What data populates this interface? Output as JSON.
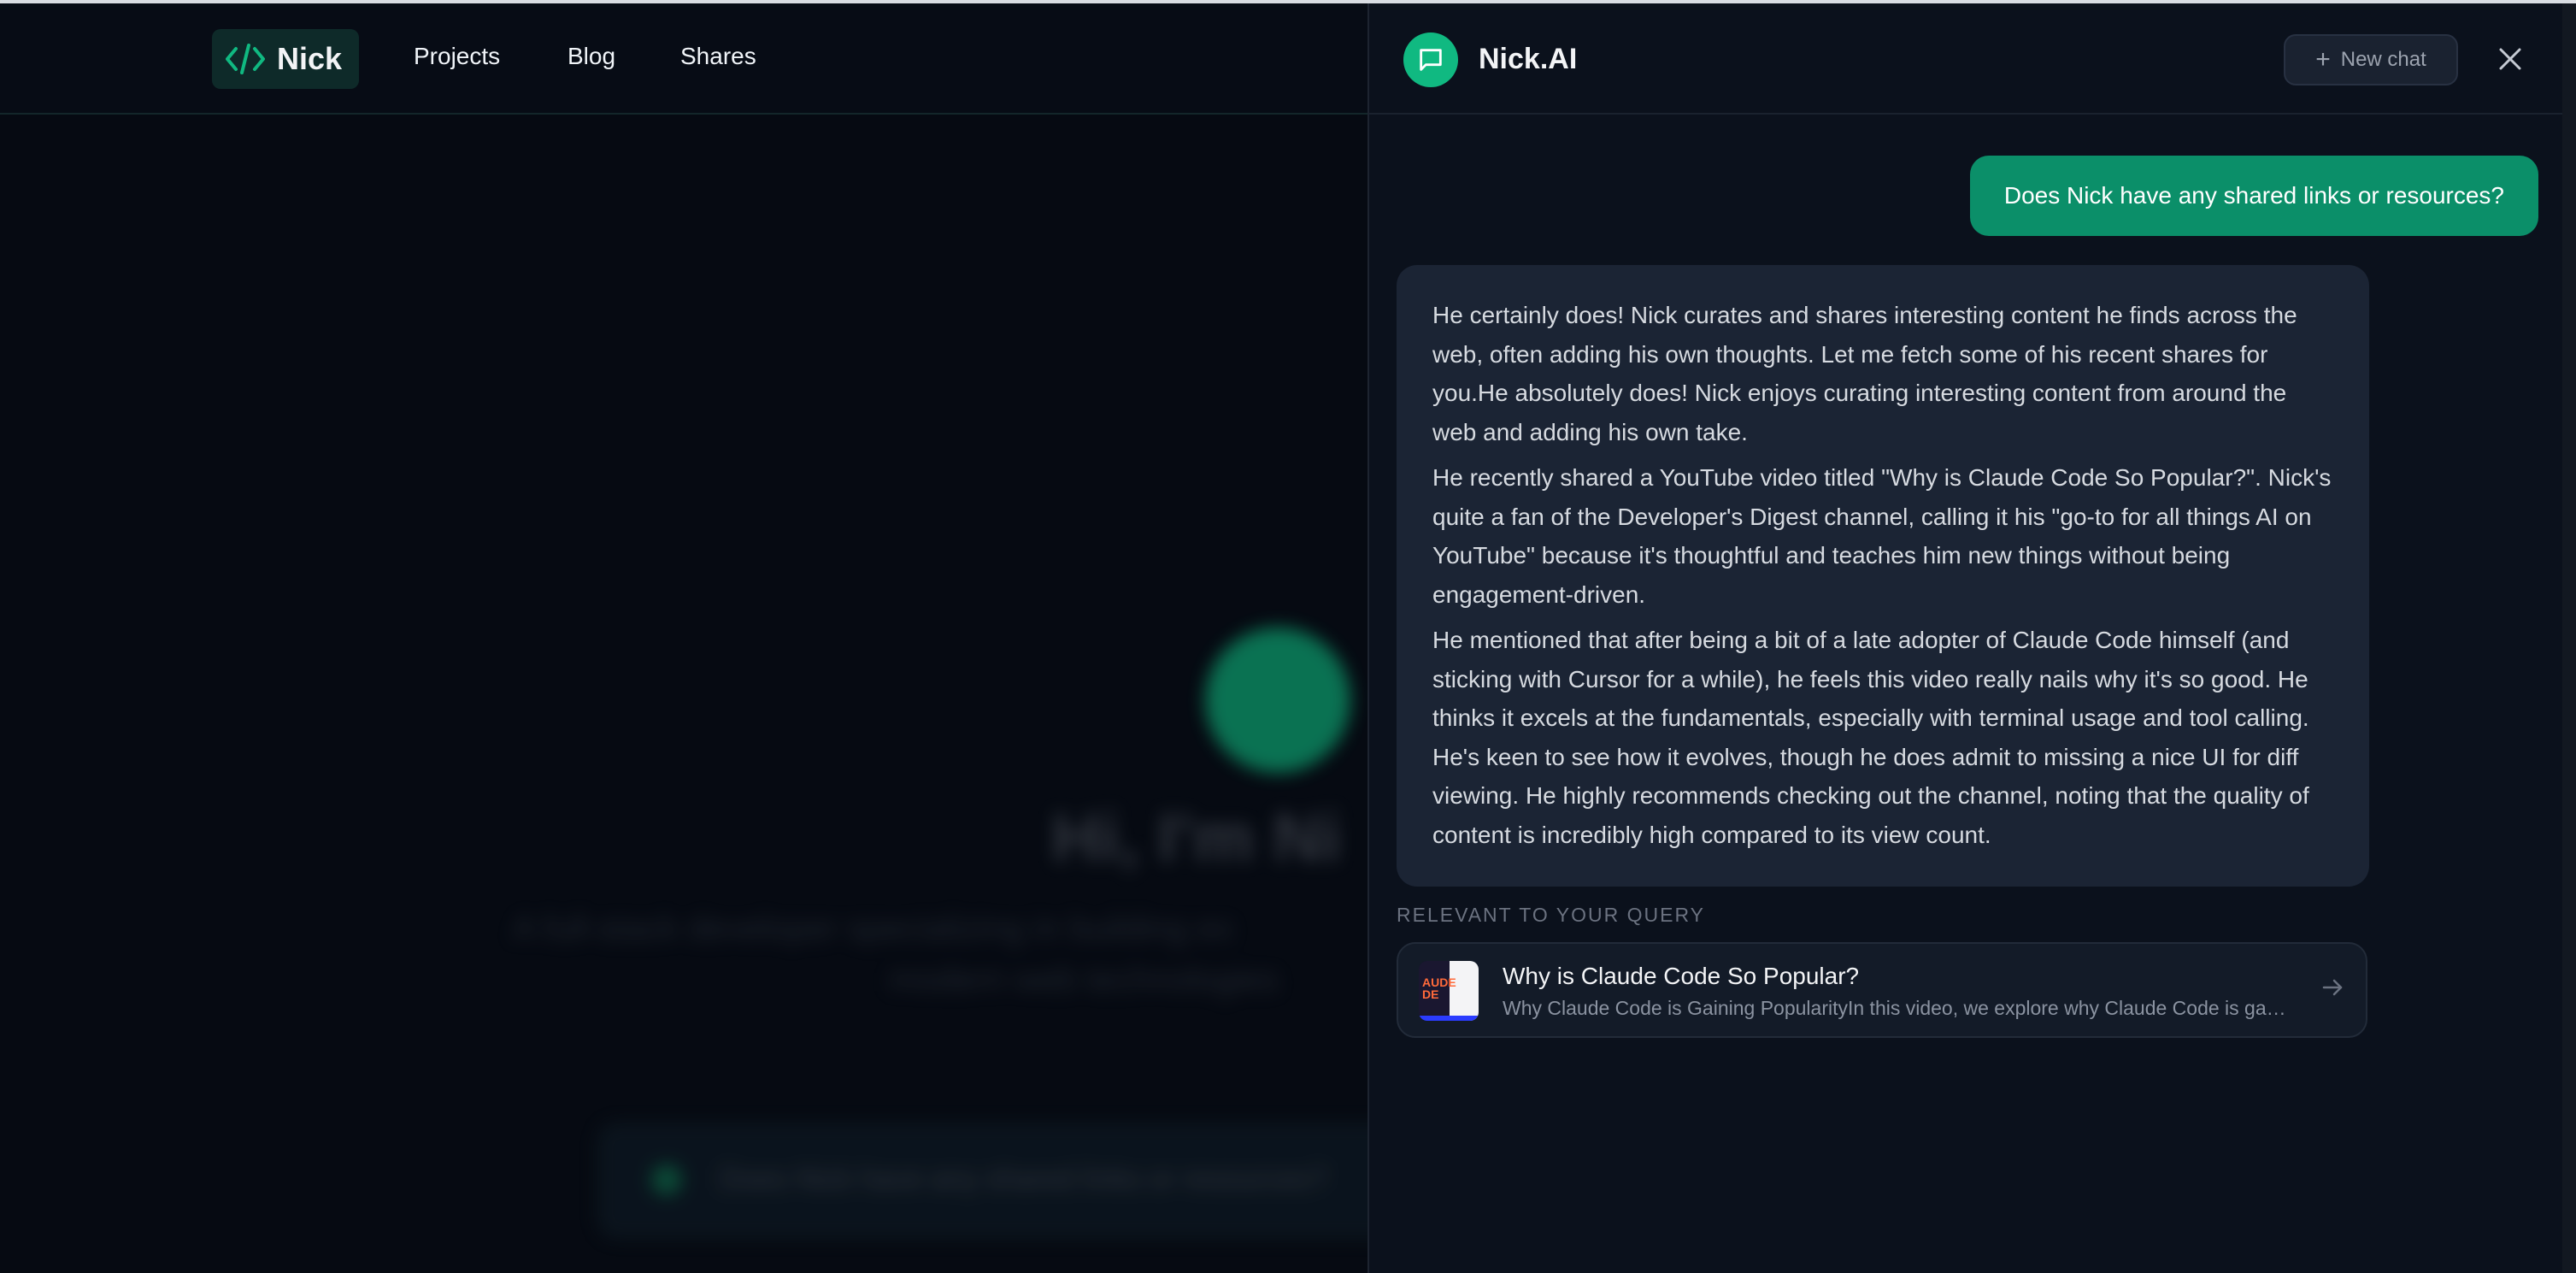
{
  "site": {
    "logo_text": "Nick",
    "nav": [
      "Projects",
      "Blog",
      "Shares"
    ],
    "background": {
      "hero_title": "Hi, I'm Ni",
      "hero_subtitle_1": "A full-stack developer specializing in building ex",
      "hero_subtitle_2": "modern web technologies",
      "input_text": "Does Nick have any shared links or resources?"
    }
  },
  "chat": {
    "title": "Nick.AI",
    "new_chat_label": "New chat",
    "user_message": "Does Nick have any shared links or resources?",
    "assistant_paragraphs": [
      "He certainly does! Nick curates and shares interesting content he finds across the web, often adding his own thoughts. Let me fetch some of his recent shares for you.He absolutely does! Nick enjoys curating interesting content from around the web and adding his own take.",
      "He recently shared a YouTube video titled \"Why is Claude Code So Popular?\". Nick's quite a fan of the Developer's Digest channel, calling it his \"go-to for all things AI on YouTube\" because it's thoughtful and teaches him new things without being engagement-driven.",
      "He mentioned that after being a bit of a late adopter of Claude Code himself (and sticking with Cursor for a while), he feels this video really nails why it's so good. He thinks it excels at the fundamentals, especially with terminal usage and tool calling. He's keen to see how it evolves, though he does admit to missing a nice UI for diff viewing. He highly recommends checking out the channel, noting that the quality of content is incredibly high compared to its view count."
    ],
    "relevant_label": "RELEVANT TO YOUR QUERY",
    "relevant_card": {
      "title": "Why is Claude Code So Popular?",
      "description": "Why Claude Code is Gaining PopularityIn this video, we explore why Claude Code is gaining popularity",
      "thumbnail_text": "AUDE\nDE"
    }
  },
  "colors": {
    "accent": "#10b981",
    "user_bubble": "#0b8f69",
    "assistant_bubble": "#1b2434",
    "panel_bg": "#0b111c"
  },
  "icons": {
    "logo": "code-brackets-icon",
    "chat_avatar": "message-square-icon",
    "new_chat": "plus-icon",
    "close": "close-icon",
    "card_arrow": "arrow-right-icon"
  }
}
